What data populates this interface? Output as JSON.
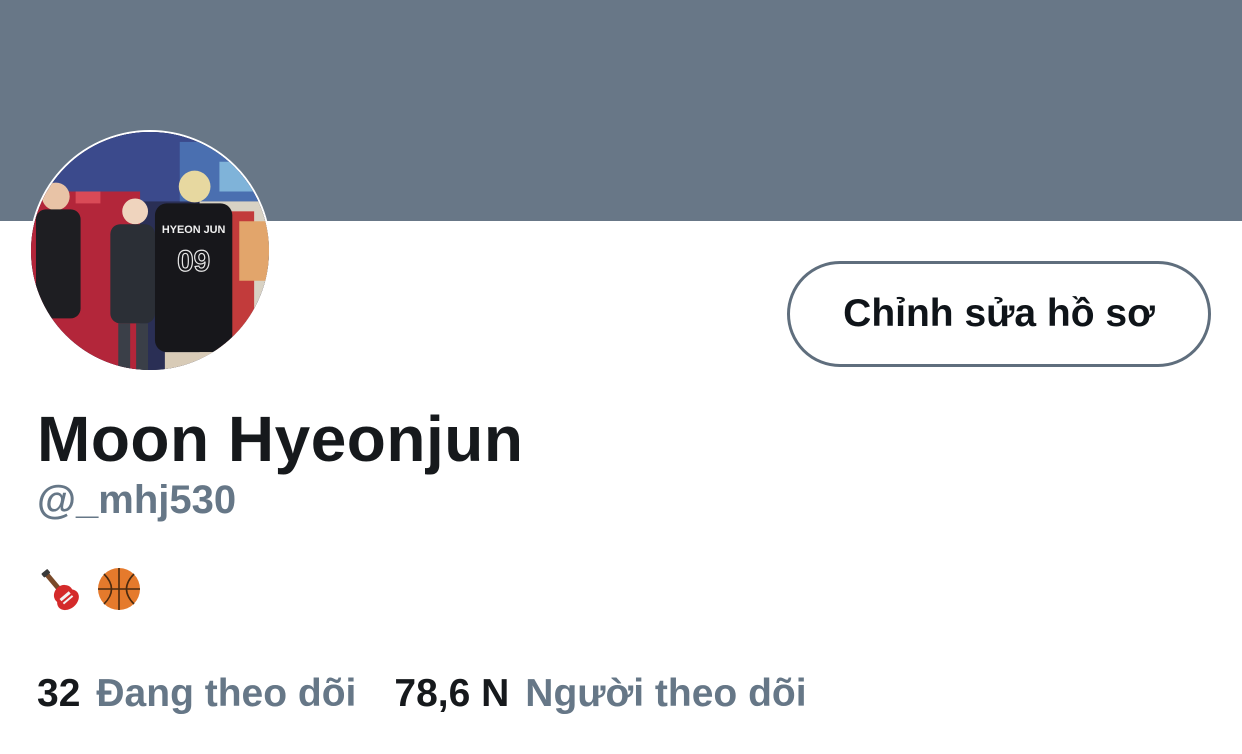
{
  "profile": {
    "name": "Moon Hyeonjun",
    "handle": "@_mhj530",
    "edit_button_label": "Chỉnh sửa hồ sơ",
    "bio_icons": [
      "guitar-icon",
      "basketball-icon"
    ],
    "avatar_jersey_text": "HYEON JUN",
    "avatar_jersey_number": "09"
  },
  "stats": {
    "following_count": "32",
    "following_label": "Đang theo dõi",
    "followers_count": "78,6 N",
    "followers_label": "Người theo dõi"
  },
  "colors": {
    "banner": "#687787",
    "secondary_text": "#667787",
    "primary_text": "#16191c"
  }
}
